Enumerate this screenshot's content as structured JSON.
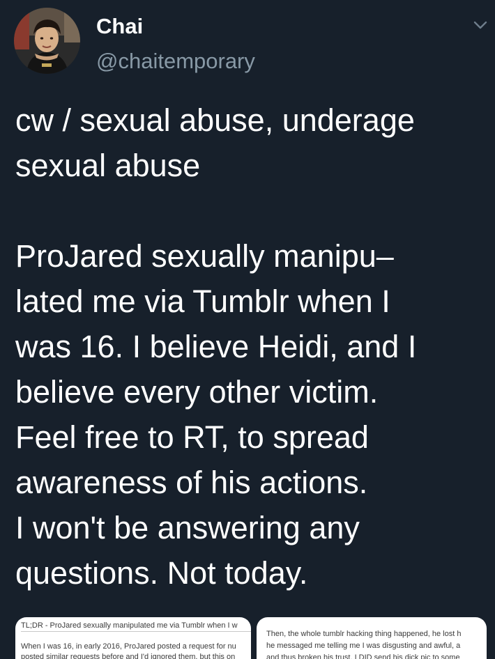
{
  "author": {
    "display_name": "Chai",
    "handle": "@chaitemporary",
    "avatar": "avatar-photo"
  },
  "menu": {
    "icon": "chevron-down-icon"
  },
  "tweet": {
    "text": "cw / sexual abuse, underage\nsexual abuse\n\nProJared sexually manipu–\nlated me via Tumblr when I\nwas 16. I believe Heidi, and I\nbelieve every other victim.\nFeel free to RT, to spread\nawareness of his actions.\nI won't be answering any\nquestions. Not today."
  },
  "attachments": [
    {
      "lines": [
        "TL;DR - ProJared sexually manipulated me via Tumblr when I w",
        "When I was 16, in early 2016, ProJared posted a request for nu",
        "posted similar requests before and I'd ignored them, but this on"
      ]
    },
    {
      "lines": [
        "Then, the whole tumblr hacking thing happened, he lost h",
        "he messaged me telling me I was disgusting and awful, a",
        "and thus broken his trust. I DID send his dick pic to some"
      ]
    }
  ],
  "colors": {
    "background": "#17202b",
    "text": "#ffffff",
    "secondary": "#8899a6",
    "attachment_bg": "#ffffff"
  }
}
